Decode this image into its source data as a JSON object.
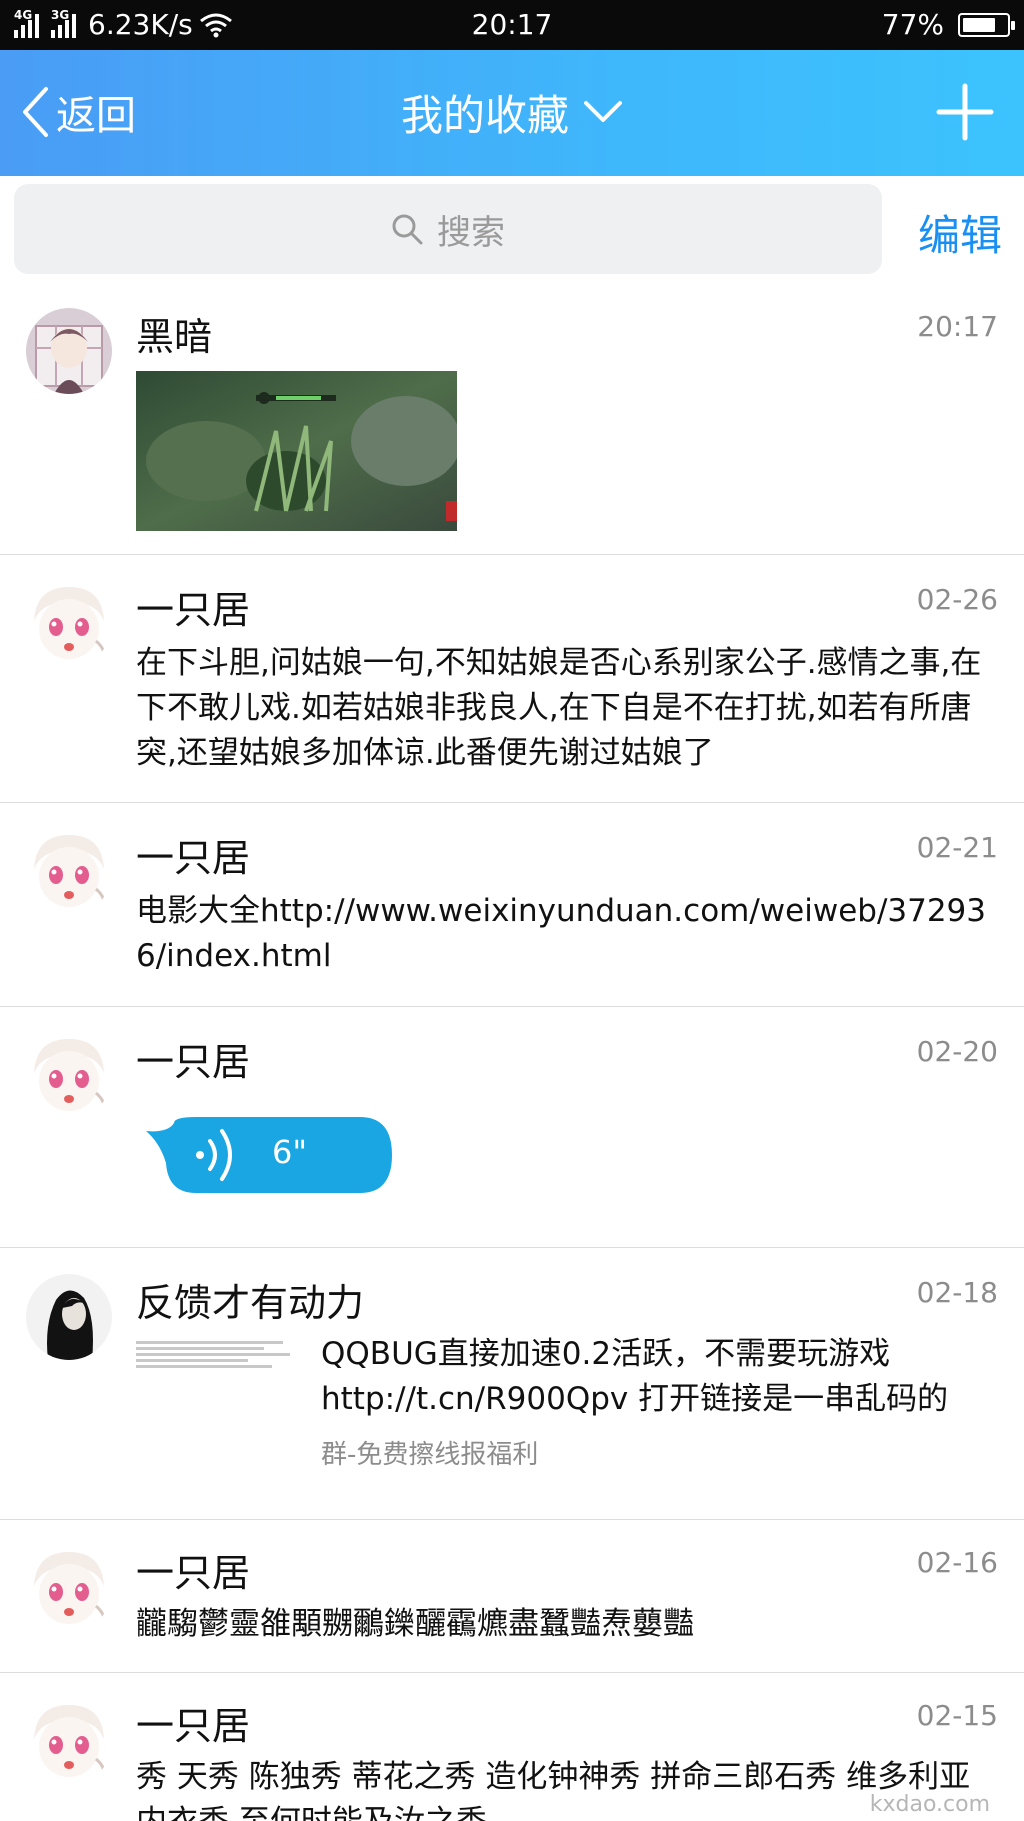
{
  "status_bar": {
    "net1": "4G",
    "net2": "3G",
    "speed": "6.23K/s",
    "time": "20:17",
    "battery_text": "77%",
    "battery_level": 0.77
  },
  "header": {
    "back_label": "返回",
    "title": "我的收藏"
  },
  "search": {
    "placeholder": "搜索",
    "edit_label": "编辑"
  },
  "items": [
    {
      "name": "黑暗",
      "date": "20:17"
    },
    {
      "name": "一只居",
      "date": "02-26",
      "text": "在下斗胆,问姑娘一句,不知姑娘是否心系别家公子.感情之事,在下不敢儿戏.如若姑娘非我良人,在下自是不在打扰,如若有所唐突,还望姑娘多加体谅.此番便先谢过姑娘了"
    },
    {
      "name": "一只居",
      "date": "02-21",
      "text": "电影大全http://www.weixinyunduan.com/weiweb/372936/index.html"
    },
    {
      "name": "一只居",
      "date": "02-20",
      "voice_duration": "6\""
    },
    {
      "name": "反馈才有动力",
      "date": "02-18",
      "text": "QQBUG直接加速0.2活跃，不需要玩游戏http://t.cn/R900Qpv  打开链接是一串乱码的",
      "source": "群-免费擦线报福利"
    },
    {
      "name": "一只居",
      "date": "02-16",
      "text": "龖騶鬱靈雒顒嬲鸍鑠釃靍爊盡蠶豔焘蘡豔"
    },
    {
      "name": "一只居",
      "date": "02-15",
      "text": "秀 天秀 陈独秀 蒂花之秀 造化钟神秀 拼命三郎石秀 维多利亚内衣秀 至何时能及汝之秀"
    }
  ],
  "watermark": "kxdao.com",
  "colors": {
    "header_start": "#4a9cf5",
    "header_end": "#3cc3fd",
    "accent": "#1a8ff3",
    "voice_bubble": "#1aa6e3"
  }
}
